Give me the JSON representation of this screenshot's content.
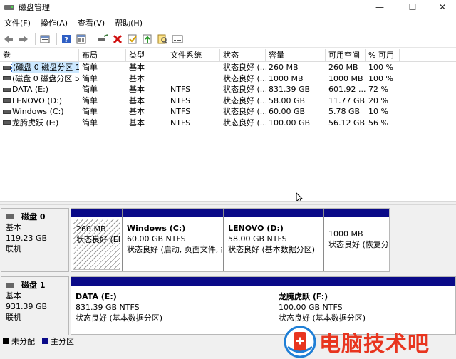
{
  "window": {
    "title": "磁盘管理",
    "min": "—",
    "max": "☐",
    "close": "✕"
  },
  "menu": [
    "文件(F)",
    "操作(A)",
    "查看(V)",
    "帮助(H)"
  ],
  "toolbar": [
    "back-icon",
    "forward-icon",
    "up-level-icon",
    "help-icon",
    "properties-icon",
    "connect-icon",
    "delete-icon",
    "check-icon",
    "import-icon",
    "search-icon",
    "console-icon"
  ],
  "columns": [
    "卷",
    "布局",
    "类型",
    "文件系统",
    "状态",
    "容量",
    "可用空间",
    "% 可用"
  ],
  "rows": [
    [
      "(磁盘 0 磁盘分区 1)",
      "简单",
      "基本",
      "",
      "状态良好 (...",
      "260 MB",
      "260 MB",
      "100 %"
    ],
    [
      "(磁盘 0 磁盘分区 5)",
      "简单",
      "基本",
      "",
      "状态良好 (...",
      "1000 MB",
      "1000 MB",
      "100 %"
    ],
    [
      "DATA (E:)",
      "简单",
      "基本",
      "NTFS",
      "状态良好 (...",
      "831.39 GB",
      "601.92 ...",
      "72 %"
    ],
    [
      "LENOVO (D:)",
      "简单",
      "基本",
      "NTFS",
      "状态良好 (...",
      "58.00 GB",
      "11.77 GB",
      "20 %"
    ],
    [
      "Windows (C:)",
      "简单",
      "基本",
      "NTFS",
      "状态良好 (...",
      "60.00 GB",
      "5.78 GB",
      "10 %"
    ],
    [
      "龙腾虎跃 (F:)",
      "简单",
      "基本",
      "NTFS",
      "状态良好 (...",
      "100.00 GB",
      "56.12 GB",
      "56 %"
    ]
  ],
  "disks": [
    {
      "name": "磁盘 0",
      "type": "基本",
      "size": "119.23 GB",
      "status": "联机",
      "parts": [
        {
          "title": "",
          "size": "260 MB",
          "state": "状态良好 (EFI 系统分区)"
        },
        {
          "title": "Windows (C:)",
          "size": "60.00 GB NTFS",
          "state": "状态良好 (启动, 页面文件, 故障转储, 基本数据分区)"
        },
        {
          "title": "LENOVO (D:)",
          "size": "58.00 GB NTFS",
          "state": "状态良好 (基本数据分区)"
        },
        {
          "title": "",
          "size": "1000 MB",
          "state": "状态良好 (恢复分区)"
        }
      ]
    },
    {
      "name": "磁盘 1",
      "type": "基本",
      "size": "931.39 GB",
      "status": "联机",
      "parts": [
        {
          "title": "DATA (E:)",
          "size": "831.39 GB NTFS",
          "state": "状态良好 (基本数据分区)"
        },
        {
          "title": "龙腾虎跃 (F:)",
          "size": "100.00 GB NTFS",
          "state": "状态良好 (基本数据分区)"
        }
      ]
    }
  ],
  "legend": [
    {
      "label": "未分配",
      "color": "#000000"
    },
    {
      "label": "主分区",
      "color": "#0a0a88"
    }
  ],
  "watermark": {
    "text": "电脑技术吧"
  },
  "colors": {
    "partition_bar": "#0a0a88",
    "selection": "#cce8ff"
  }
}
